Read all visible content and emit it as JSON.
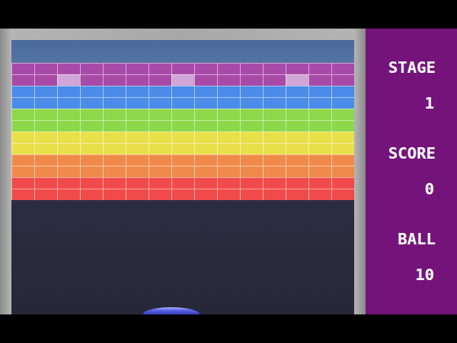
{
  "bricks": {
    "rows": [
      {
        "color": "#a84aa8",
        "bricks": [
          {
            "kind": "normal"
          },
          {
            "kind": "normal"
          },
          {
            "kind": "normal"
          },
          {
            "kind": "normal"
          },
          {
            "kind": "normal"
          },
          {
            "kind": "normal"
          },
          {
            "kind": "normal"
          },
          {
            "kind": "normal"
          },
          {
            "kind": "normal"
          },
          {
            "kind": "normal"
          },
          {
            "kind": "normal"
          },
          {
            "kind": "normal"
          },
          {
            "kind": "normal"
          },
          {
            "kind": "normal"
          },
          {
            "kind": "normal"
          }
        ]
      },
      {
        "color": "#a84aa8",
        "bricks": [
          {
            "kind": "normal"
          },
          {
            "kind": "normal"
          },
          {
            "kind": "hard"
          },
          {
            "kind": "normal"
          },
          {
            "kind": "normal"
          },
          {
            "kind": "normal"
          },
          {
            "kind": "normal"
          },
          {
            "kind": "hard"
          },
          {
            "kind": "normal"
          },
          {
            "kind": "normal"
          },
          {
            "kind": "normal"
          },
          {
            "kind": "normal"
          },
          {
            "kind": "hard"
          },
          {
            "kind": "normal"
          },
          {
            "kind": "normal"
          }
        ]
      },
      {
        "color": "#4a8ce8",
        "bricks": [
          {
            "kind": "normal"
          },
          {
            "kind": "normal"
          },
          {
            "kind": "normal"
          },
          {
            "kind": "normal"
          },
          {
            "kind": "normal"
          },
          {
            "kind": "normal"
          },
          {
            "kind": "normal"
          },
          {
            "kind": "normal"
          },
          {
            "kind": "normal"
          },
          {
            "kind": "normal"
          },
          {
            "kind": "normal"
          },
          {
            "kind": "normal"
          },
          {
            "kind": "normal"
          },
          {
            "kind": "normal"
          },
          {
            "kind": "normal"
          }
        ]
      },
      {
        "color": "#4a8ce8",
        "bricks": [
          {
            "kind": "normal"
          },
          {
            "kind": "normal"
          },
          {
            "kind": "normal"
          },
          {
            "kind": "normal"
          },
          {
            "kind": "normal"
          },
          {
            "kind": "normal"
          },
          {
            "kind": "normal"
          },
          {
            "kind": "normal"
          },
          {
            "kind": "normal"
          },
          {
            "kind": "normal"
          },
          {
            "kind": "normal"
          },
          {
            "kind": "normal"
          },
          {
            "kind": "normal"
          },
          {
            "kind": "normal"
          },
          {
            "kind": "normal"
          }
        ]
      },
      {
        "color": "#8cd84a",
        "bricks": [
          {
            "kind": "normal"
          },
          {
            "kind": "normal"
          },
          {
            "kind": "normal"
          },
          {
            "kind": "normal"
          },
          {
            "kind": "normal"
          },
          {
            "kind": "normal"
          },
          {
            "kind": "normal"
          },
          {
            "kind": "normal"
          },
          {
            "kind": "normal"
          },
          {
            "kind": "normal"
          },
          {
            "kind": "normal"
          },
          {
            "kind": "normal"
          },
          {
            "kind": "normal"
          },
          {
            "kind": "normal"
          },
          {
            "kind": "normal"
          }
        ]
      },
      {
        "color": "#8cd84a",
        "bricks": [
          {
            "kind": "normal"
          },
          {
            "kind": "normal"
          },
          {
            "kind": "normal"
          },
          {
            "kind": "normal"
          },
          {
            "kind": "normal"
          },
          {
            "kind": "normal"
          },
          {
            "kind": "normal"
          },
          {
            "kind": "normal"
          },
          {
            "kind": "normal"
          },
          {
            "kind": "normal"
          },
          {
            "kind": "normal"
          },
          {
            "kind": "normal"
          },
          {
            "kind": "normal"
          },
          {
            "kind": "normal"
          },
          {
            "kind": "normal"
          }
        ]
      },
      {
        "color": "#e8e048",
        "bricks": [
          {
            "kind": "normal"
          },
          {
            "kind": "normal"
          },
          {
            "kind": "normal"
          },
          {
            "kind": "normal"
          },
          {
            "kind": "normal"
          },
          {
            "kind": "normal"
          },
          {
            "kind": "normal"
          },
          {
            "kind": "normal"
          },
          {
            "kind": "normal"
          },
          {
            "kind": "normal"
          },
          {
            "kind": "normal"
          },
          {
            "kind": "normal"
          },
          {
            "kind": "normal"
          },
          {
            "kind": "normal"
          },
          {
            "kind": "normal"
          }
        ]
      },
      {
        "color": "#e8e048",
        "bricks": [
          {
            "kind": "normal"
          },
          {
            "kind": "normal"
          },
          {
            "kind": "normal"
          },
          {
            "kind": "normal"
          },
          {
            "kind": "normal"
          },
          {
            "kind": "normal"
          },
          {
            "kind": "normal"
          },
          {
            "kind": "normal"
          },
          {
            "kind": "normal"
          },
          {
            "kind": "normal"
          },
          {
            "kind": "normal"
          },
          {
            "kind": "normal"
          },
          {
            "kind": "normal"
          },
          {
            "kind": "normal"
          },
          {
            "kind": "normal"
          }
        ]
      },
      {
        "color": "#f08a4a",
        "bricks": [
          {
            "kind": "normal"
          },
          {
            "kind": "normal"
          },
          {
            "kind": "normal"
          },
          {
            "kind": "normal"
          },
          {
            "kind": "normal"
          },
          {
            "kind": "normal"
          },
          {
            "kind": "normal"
          },
          {
            "kind": "normal"
          },
          {
            "kind": "normal"
          },
          {
            "kind": "normal"
          },
          {
            "kind": "normal"
          },
          {
            "kind": "normal"
          },
          {
            "kind": "normal"
          },
          {
            "kind": "normal"
          },
          {
            "kind": "normal"
          }
        ]
      },
      {
        "color": "#f08a4a",
        "bricks": [
          {
            "kind": "normal"
          },
          {
            "kind": "normal"
          },
          {
            "kind": "normal"
          },
          {
            "kind": "normal"
          },
          {
            "kind": "normal"
          },
          {
            "kind": "normal"
          },
          {
            "kind": "normal"
          },
          {
            "kind": "normal"
          },
          {
            "kind": "normal"
          },
          {
            "kind": "normal"
          },
          {
            "kind": "normal"
          },
          {
            "kind": "normal"
          },
          {
            "kind": "normal"
          },
          {
            "kind": "normal"
          },
          {
            "kind": "normal"
          }
        ]
      },
      {
        "color": "#f04a4a",
        "bricks": [
          {
            "kind": "normal"
          },
          {
            "kind": "normal"
          },
          {
            "kind": "normal"
          },
          {
            "kind": "normal"
          },
          {
            "kind": "normal"
          },
          {
            "kind": "normal"
          },
          {
            "kind": "normal"
          },
          {
            "kind": "normal"
          },
          {
            "kind": "normal"
          },
          {
            "kind": "normal"
          },
          {
            "kind": "normal"
          },
          {
            "kind": "normal"
          },
          {
            "kind": "normal"
          },
          {
            "kind": "normal"
          },
          {
            "kind": "normal"
          }
        ]
      },
      {
        "color": "#f04a4a",
        "bricks": [
          {
            "kind": "normal"
          },
          {
            "kind": "normal"
          },
          {
            "kind": "normal"
          },
          {
            "kind": "normal"
          },
          {
            "kind": "normal"
          },
          {
            "kind": "normal"
          },
          {
            "kind": "normal"
          },
          {
            "kind": "normal"
          },
          {
            "kind": "normal"
          },
          {
            "kind": "normal"
          },
          {
            "kind": "normal"
          },
          {
            "kind": "normal"
          },
          {
            "kind": "normal"
          },
          {
            "kind": "normal"
          },
          {
            "kind": "normal"
          }
        ]
      }
    ]
  },
  "panel": {
    "items": [
      {
        "label": "STAGE",
        "value": "1"
      },
      {
        "label": "SCORE",
        "value": "0"
      },
      {
        "label": "BALL",
        "value": "10"
      }
    ]
  }
}
